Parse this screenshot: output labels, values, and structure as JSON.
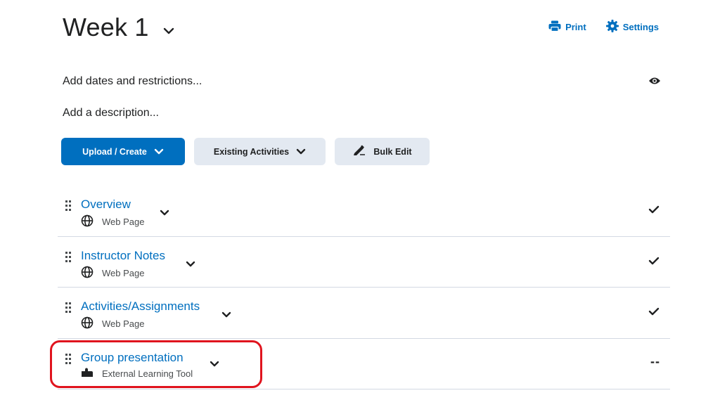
{
  "header": {
    "title": "Week 1"
  },
  "actions": {
    "print_label": "Print",
    "settings_label": "Settings"
  },
  "meta": {
    "dates_label": "Add dates and restrictions...",
    "description_label": "Add a description..."
  },
  "toolbar": {
    "upload_label": "Upload / Create",
    "existing_label": "Existing Activities",
    "bulk_label": "Bulk Edit"
  },
  "items": [
    {
      "title": "Overview",
      "type": "Web Page",
      "icon": "globe-icon",
      "status": "check"
    },
    {
      "title": "Instructor Notes",
      "type": "Web Page",
      "icon": "globe-icon",
      "status": "check"
    },
    {
      "title": "Activities/Assignments",
      "type": "Web Page",
      "icon": "globe-icon",
      "status": "check"
    },
    {
      "title": "Group presentation",
      "type": "External Learning Tool",
      "icon": "puzzle-icon",
      "status": "--"
    }
  ],
  "colors": {
    "accent": "#006fbf",
    "secondary_button": "#e3e9f1",
    "highlight": "#e0141e"
  }
}
